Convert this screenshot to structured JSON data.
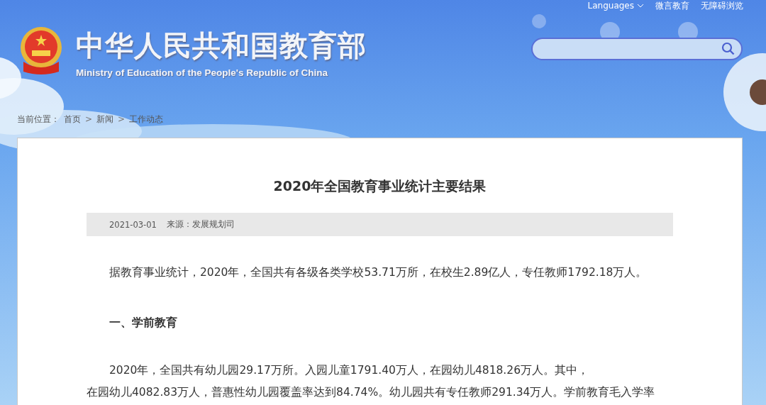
{
  "top_links": [
    {
      "label": "Languages",
      "kind": "dropdown"
    },
    {
      "label": "微言教育",
      "kind": "link"
    },
    {
      "label": "无障碍浏览",
      "kind": "link"
    }
  ],
  "header": {
    "title": "中华人民共和国教育部",
    "subtitle": "Ministry of Education of the People's Republic of China"
  },
  "breadcrumb": {
    "label": "当前位置：",
    "items": [
      "首页",
      "新闻",
      "工作动态"
    ],
    "separator": ">"
  },
  "article": {
    "title": "2020年全国教育事业统计主要结果",
    "date": "2021-03-01",
    "source": "来源：发展规划司",
    "blocks": [
      {
        "kind": "paragraph",
        "lines": [
          "据教育事业统计，2020年，全国共有各级各类学校53.71万所，在校生2.89亿人，专任教师1792.18万人。"
        ]
      },
      {
        "kind": "heading",
        "lines": [
          "一、学前教育"
        ]
      },
      {
        "kind": "paragraph",
        "lines": [
          "2020年，全国共有幼儿园29.17万所。入园儿童1791.40万人，在园幼儿4818.26万人。其中，",
          "在园幼儿4082.83万人，普惠性幼儿园覆盖率达到84.74%。幼儿园共有专任教师291.34万人。学前教育毛入学率"
        ]
      }
    ]
  }
}
